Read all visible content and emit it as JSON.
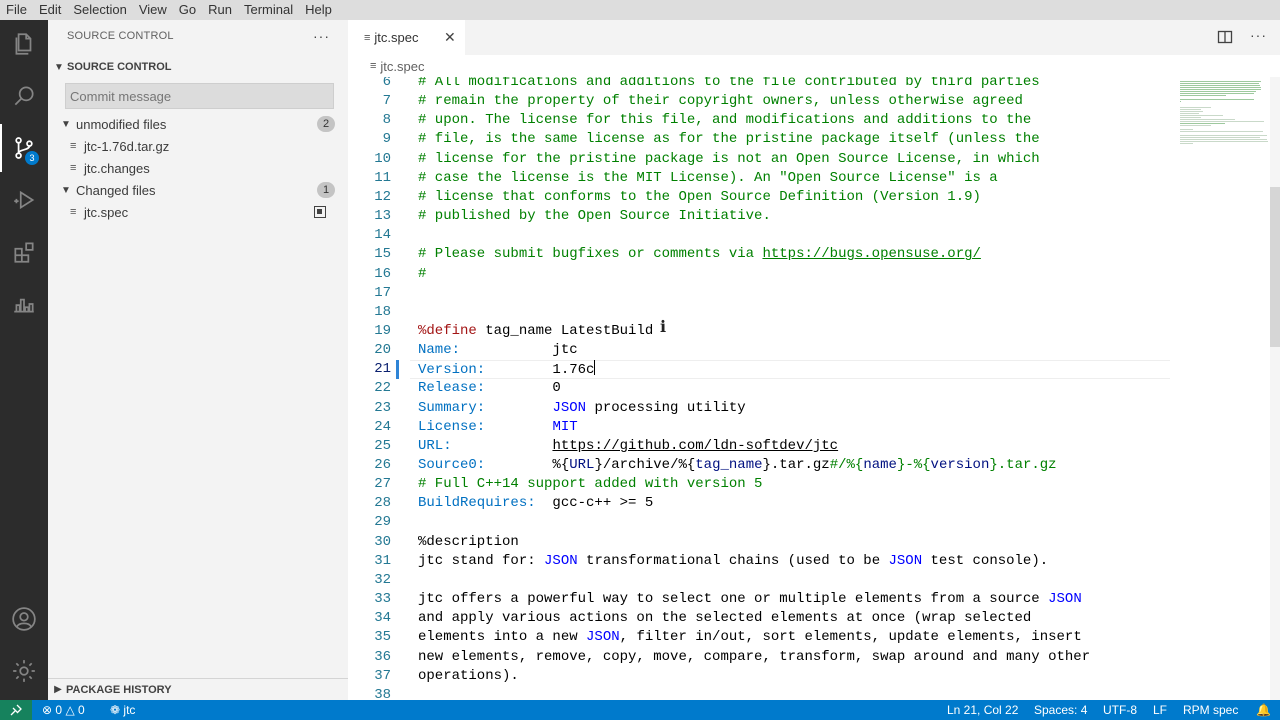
{
  "menubar": [
    "File",
    "Edit",
    "Selection",
    "View",
    "Go",
    "Run",
    "Terminal",
    "Help"
  ],
  "activity_bar": {
    "items": [
      "files-icon",
      "search-icon",
      "source-control-icon",
      "run-debug-icon",
      "extensions-icon",
      "remote-icon"
    ],
    "scm_badge": "3",
    "bottom": [
      "account-icon",
      "settings-gear-icon"
    ]
  },
  "sidebar": {
    "title": "SOURCE CONTROL",
    "section_title": "SOURCE CONTROL",
    "commit_placeholder": "Commit message",
    "groups": [
      {
        "label": "unmodified files",
        "count": "2",
        "files": [
          "jtc-1.76d.tar.gz",
          "jtc.changes"
        ]
      },
      {
        "label": "Changed files",
        "count": "1",
        "files": [
          "jtc.spec"
        ]
      }
    ],
    "package_history": "PACKAGE HISTORY"
  },
  "editor": {
    "tab_label": "jtc.spec",
    "breadcrumb": "jtc.spec",
    "cursor_line": 21,
    "lines": [
      {
        "n": "6",
        "t": "# All modifications and additions to the file contributed by third parties",
        "k": "com"
      },
      {
        "n": "7",
        "t": "# remain the property of their copyright owners, unless otherwise agreed",
        "k": "com"
      },
      {
        "n": "8",
        "t": "# upon. The license for this file, and modifications and additions to the",
        "k": "com"
      },
      {
        "n": "9",
        "t": "# file, is the same license as for the pristine package itself (unless the",
        "k": "com"
      },
      {
        "n": "10",
        "t": "# license for the pristine package is not an Open Source License, in which",
        "k": "com"
      },
      {
        "n": "11",
        "t": "# case the license is the MIT License). An \"Open Source License\" is a",
        "k": "com"
      },
      {
        "n": "12",
        "t": "# license that conforms to the Open Source Definition (Version 1.9)",
        "k": "com"
      },
      {
        "n": "13",
        "t": "# published by the Open Source Initiative.",
        "k": "com"
      },
      {
        "n": "14",
        "t": "",
        "k": "plain"
      },
      {
        "n": "15",
        "t": "# Please submit bugfixes or comments via https://bugs.opensuse.org/",
        "k": "com"
      },
      {
        "n": "16",
        "t": "#",
        "k": "com"
      },
      {
        "n": "17",
        "t": "",
        "k": "plain"
      },
      {
        "n": "18",
        "t": "",
        "k": "plain"
      },
      {
        "n": "19",
        "t": "%define tag_name LatestBuild",
        "k": "define"
      },
      {
        "n": "20",
        "t": "Name:           jtc",
        "k": "tag"
      },
      {
        "n": "21",
        "t": "Version:        1.76c",
        "k": "tag"
      },
      {
        "n": "22",
        "t": "Release:        0",
        "k": "tag"
      },
      {
        "n": "23",
        "t": "Summary:        JSON processing utility",
        "k": "tag"
      },
      {
        "n": "24",
        "t": "License:        MIT",
        "k": "tag"
      },
      {
        "n": "25",
        "t": "URL:            https://github.com/ldn-softdev/jtc",
        "k": "tag"
      },
      {
        "n": "26",
        "t": "Source0:        %{URL}/archive/%{tag_name}.tar.gz#/%{name}-%{version}.tar.gz",
        "k": "tag"
      },
      {
        "n": "27",
        "t": "# Full C++14 support added with version 5",
        "k": "com"
      },
      {
        "n": "28",
        "t": "BuildRequires:  gcc-c++ >= 5",
        "k": "tag"
      },
      {
        "n": "29",
        "t": "",
        "k": "plain"
      },
      {
        "n": "30",
        "t": "%description",
        "k": "plain"
      },
      {
        "n": "31",
        "t": "jtc stand for: JSON transformational chains (used to be JSON test console).",
        "k": "plain"
      },
      {
        "n": "32",
        "t": "",
        "k": "plain"
      },
      {
        "n": "33",
        "t": "jtc offers a powerful way to select one or multiple elements from a source JSON",
        "k": "plain"
      },
      {
        "n": "34",
        "t": "and apply various actions on the selected elements at once (wrap selected",
        "k": "plain"
      },
      {
        "n": "35",
        "t": "elements into a new JSON, filter in/out, sort elements, update elements, insert",
        "k": "plain"
      },
      {
        "n": "36",
        "t": "new elements, remove, copy, move, compare, transform, swap around and many other",
        "k": "plain"
      },
      {
        "n": "37",
        "t": "operations).",
        "k": "plain"
      },
      {
        "n": "38",
        "t": "",
        "k": "plain"
      }
    ]
  },
  "statusbar": {
    "errors": "0",
    "warnings": "0",
    "branch": "jtc",
    "position": "Ln 21, Col 22",
    "spaces": "Spaces: 4",
    "encoding": "UTF-8",
    "eol": "LF",
    "language": "RPM spec"
  },
  "colors": {
    "accent": "#007acc",
    "comment": "#008000",
    "keyword": "#0000ff",
    "line_number": "#237893"
  }
}
